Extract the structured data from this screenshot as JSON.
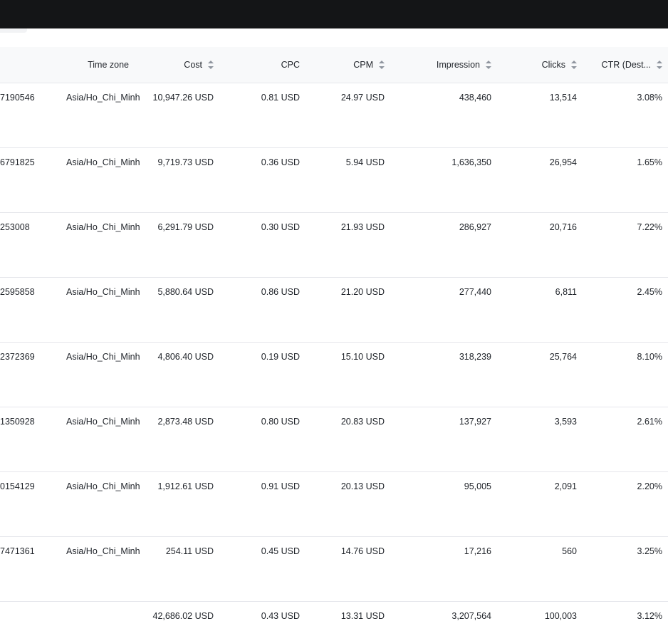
{
  "columns": {
    "time_zone": "Time zone",
    "cost": "Cost",
    "cpc": "CPC",
    "cpm": "CPM",
    "impression": "Impression",
    "clicks": "Clicks",
    "ctr": "CTR (Dest..."
  },
  "rows": [
    {
      "id": "7190546",
      "tz": "Asia/Ho_Chi_Minh",
      "cost": "10,947.26 USD",
      "cpc": "0.81 USD",
      "cpm": "24.97 USD",
      "impression": "438,460",
      "clicks": "13,514",
      "ctr": "3.08%"
    },
    {
      "id": "6791825",
      "tz": "Asia/Ho_Chi_Minh",
      "cost": "9,719.73 USD",
      "cpc": "0.36 USD",
      "cpm": "5.94 USD",
      "impression": "1,636,350",
      "clicks": "26,954",
      "ctr": "1.65%"
    },
    {
      "id": "253008",
      "tz": "Asia/Ho_Chi_Minh",
      "cost": "6,291.79 USD",
      "cpc": "0.30 USD",
      "cpm": "21.93 USD",
      "impression": "286,927",
      "clicks": "20,716",
      "ctr": "7.22%"
    },
    {
      "id": "2595858",
      "tz": "Asia/Ho_Chi_Minh",
      "cost": "5,880.64 USD",
      "cpc": "0.86 USD",
      "cpm": "21.20 USD",
      "impression": "277,440",
      "clicks": "6,811",
      "ctr": "2.45%"
    },
    {
      "id": "2372369",
      "tz": "Asia/Ho_Chi_Minh",
      "cost": "4,806.40 USD",
      "cpc": "0.19 USD",
      "cpm": "15.10 USD",
      "impression": "318,239",
      "clicks": "25,764",
      "ctr": "8.10%"
    },
    {
      "id": "1350928",
      "tz": "Asia/Ho_Chi_Minh",
      "cost": "2,873.48 USD",
      "cpc": "0.80 USD",
      "cpm": "20.83 USD",
      "impression": "137,927",
      "clicks": "3,593",
      "ctr": "2.61%"
    },
    {
      "id": "0154129",
      "tz": "Asia/Ho_Chi_Minh",
      "cost": "1,912.61 USD",
      "cpc": "0.91 USD",
      "cpm": "20.13 USD",
      "impression": "95,005",
      "clicks": "2,091",
      "ctr": "2.20%"
    },
    {
      "id": "7471361",
      "tz": "Asia/Ho_Chi_Minh",
      "cost": "254.11 USD",
      "cpc": "0.45 USD",
      "cpm": "14.76 USD",
      "impression": "17,216",
      "clicks": "560",
      "ctr": "3.25%"
    }
  ],
  "totals": {
    "cost": "42,686.02 USD",
    "cpc": "0.43 USD",
    "cpm": "13.31 USD",
    "impression": "3,207,564",
    "clicks": "100,003",
    "ctr": "3.12%"
  },
  "icons": {
    "sort": "sort-icon"
  },
  "colors": {
    "topbar": "#141517",
    "header_bg": "#f8f9fa",
    "divider": "#e5e6eb"
  }
}
